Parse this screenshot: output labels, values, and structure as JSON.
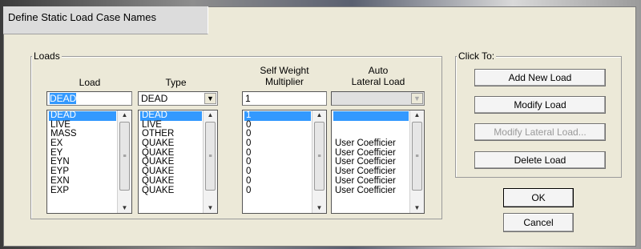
{
  "window": {
    "title": "Define Static Load Case Names"
  },
  "loads": {
    "legend": "Loads",
    "headers": {
      "load": "Load",
      "type": "Type",
      "self_weight_line1": "Self Weight",
      "self_weight_line2": "Multiplier",
      "auto_line1": "Auto",
      "auto_line2": "Lateral Load"
    },
    "inputs": {
      "load_value": "DEAD",
      "type_value": "DEAD",
      "multiplier_value": "1",
      "auto_value": ""
    },
    "load_list": [
      "DEAD",
      "LIVE",
      "MASS",
      "EX",
      "EY",
      "EYN",
      "EYP",
      "EXN",
      "EXP"
    ],
    "type_list": [
      "DEAD",
      "LIVE",
      "OTHER",
      "QUAKE",
      "QUAKE",
      "QUAKE",
      "QUAKE",
      "QUAKE",
      "QUAKE"
    ],
    "multiplier_list": [
      "1",
      "0",
      "0",
      "0",
      "0",
      "0",
      "0",
      "0",
      "0"
    ],
    "auto_list": [
      "",
      "",
      "",
      "User Coefficier",
      "User Coefficier",
      "User Coefficier",
      "User Coefficier",
      "User Coefficier",
      "User Coefficier"
    ],
    "selected_index": 0
  },
  "click_to": {
    "legend": "Click To:",
    "add_new_load": "Add New Load",
    "modify_load": "Modify Load",
    "modify_lateral_load": "Modify Lateral Load...",
    "delete_load": "Delete Load"
  },
  "buttons": {
    "ok": "OK",
    "cancel": "Cancel"
  },
  "icons": {
    "combo_arrow": "chevron-down-icon",
    "scroll_up": "scroll-up-icon",
    "scroll_down": "scroll-down-icon",
    "scroll_grip": "scroll-grip-icon"
  }
}
